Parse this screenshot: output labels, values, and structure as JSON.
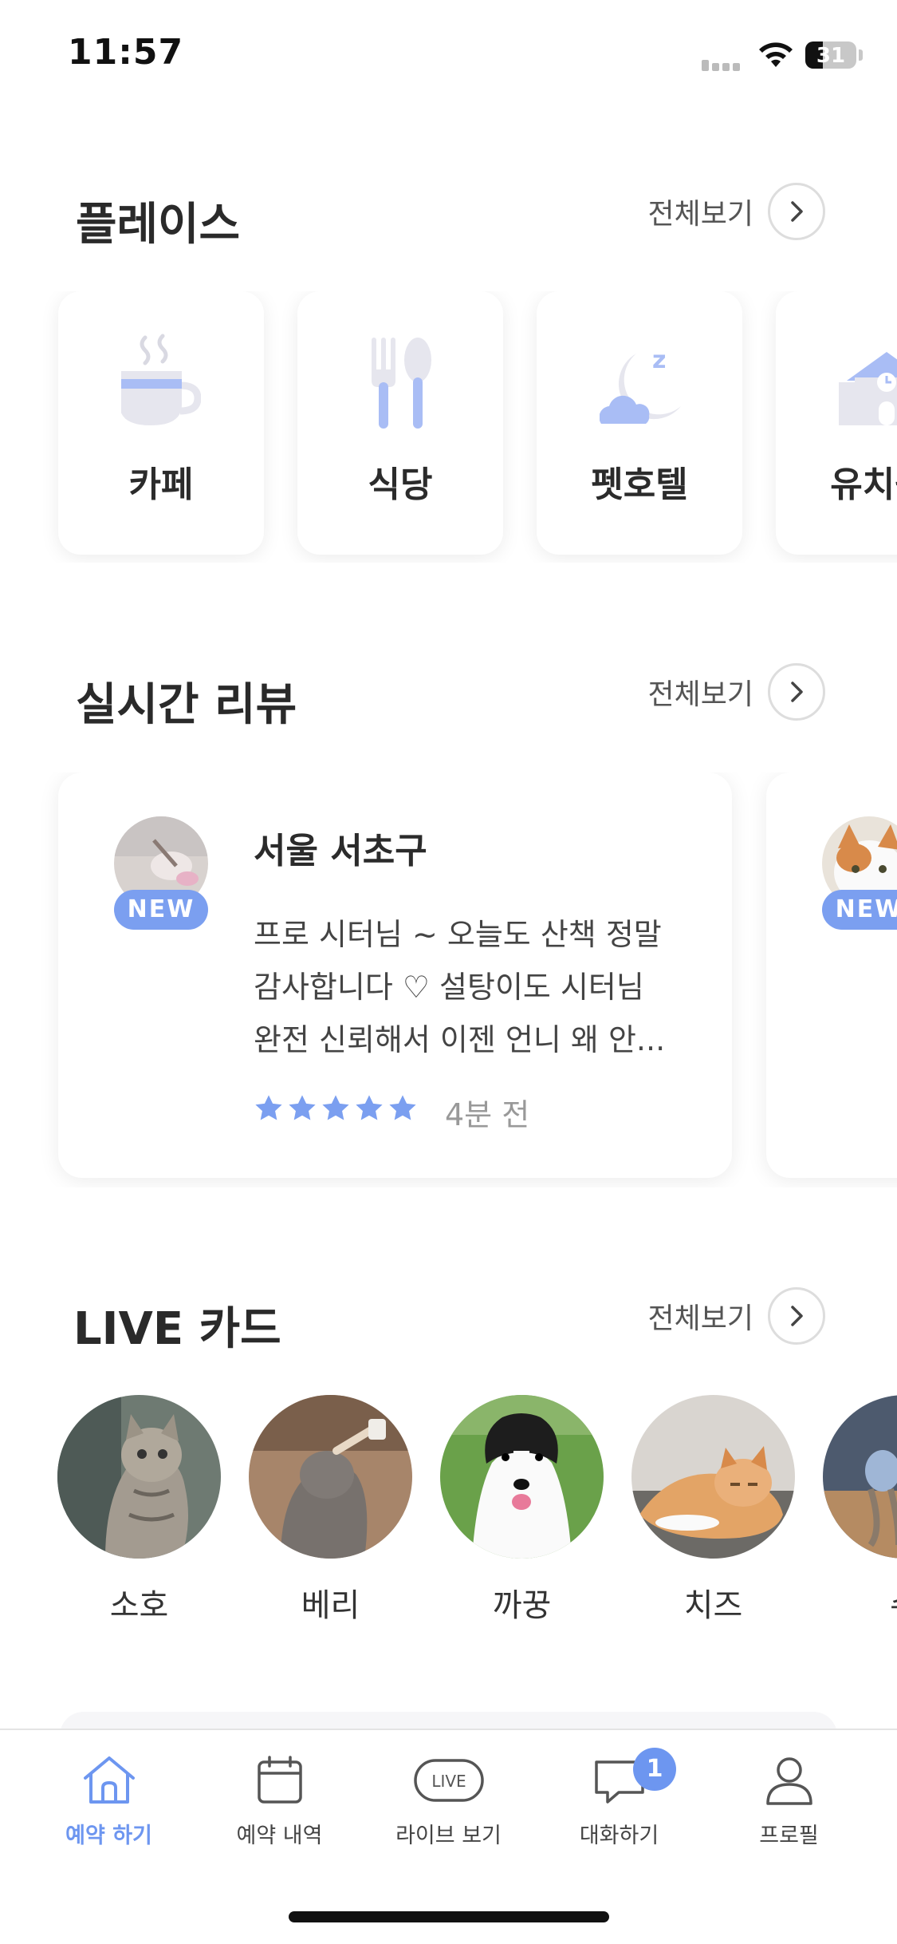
{
  "status_bar": {
    "time": "11:57",
    "battery": "31"
  },
  "places": {
    "title": "플레이스",
    "more_label": "전체보기",
    "items": [
      {
        "label": "카페",
        "icon": "coffee-cup-icon"
      },
      {
        "label": "식당",
        "icon": "fork-spoon-icon"
      },
      {
        "label": "펫호텔",
        "icon": "moon-sleep-icon"
      },
      {
        "label": "유치원",
        "icon": "school-building-icon"
      }
    ]
  },
  "reviews": {
    "title": "실시간 리뷰",
    "more_label": "전체보기",
    "items": [
      {
        "badge": "NEW",
        "region": "서울 서초구",
        "text_lines": [
          "프로 시터님 ~ 오늘도 산책 정말",
          "감사합니다 ♡ 설탕이도 시터님",
          "완전 신뢰해서 이젠 언니 왜 안..."
        ],
        "rating": 5,
        "time": "4분 전"
      },
      {
        "badge": "NEW"
      }
    ]
  },
  "live": {
    "title": "LIVE 카드",
    "more_label": "전체보기",
    "items": [
      {
        "name": "소호"
      },
      {
        "name": "베리"
      },
      {
        "name": "까꿍"
      },
      {
        "name": "치즈"
      },
      {
        "name": "수"
      }
    ]
  },
  "tabbar": {
    "items": [
      {
        "label": "예약 하기",
        "icon": "home-icon",
        "active": true
      },
      {
        "label": "예약 내역",
        "icon": "calendar-icon"
      },
      {
        "label": "라이브 보기",
        "icon": "live-icon",
        "icon_text": "LIVE"
      },
      {
        "label": "대화하기",
        "icon": "chat-icon",
        "badge": "1"
      },
      {
        "label": "프로필",
        "icon": "profile-icon"
      }
    ]
  },
  "colors": {
    "accent": "#6d96f0",
    "icon_light": "#a9bdf5",
    "icon_gray": "#e6e6ee"
  }
}
